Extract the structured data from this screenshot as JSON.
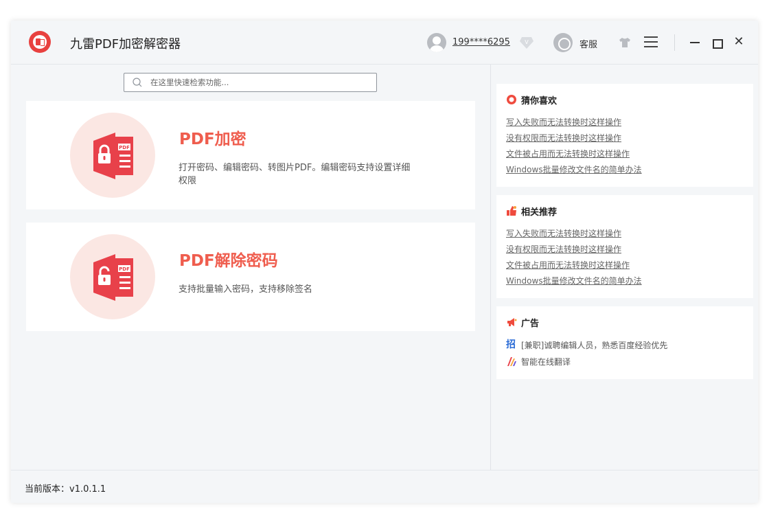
{
  "app": {
    "title": "九雷PDF加密解密器",
    "brand_color": "#e8413f"
  },
  "header": {
    "user_name": "199****6295",
    "service_label": "客服",
    "close_glyph": "✕",
    "icons": [
      "user-avatar-icon",
      "vip-badge-icon",
      "customer-service-icon",
      "skin-icon",
      "menu-icon",
      "minimize-icon",
      "maximize-icon",
      "close-icon"
    ]
  },
  "search": {
    "placeholder": "在这里快速检索功能..."
  },
  "features": [
    {
      "title": "PDF加密",
      "desc": "打开密码、编辑密码、转图片PDF。编辑密码支持设置详细权限",
      "icon": "pdf-lock-icon"
    },
    {
      "title": "PDF解除密码",
      "desc": "支持批量输入密码，支持移除签名",
      "icon": "pdf-unlock-icon"
    }
  ],
  "sidebar": {
    "guess": {
      "title": "猜你喜欢",
      "links": [
        "写入失败而无法转换时这样操作",
        "没有权限而无法转换时这样操作",
        "文件被占用而无法转换时这样操作",
        "Windows批量修改文件名的简单办法"
      ]
    },
    "recommend": {
      "title": "相关推荐",
      "links": [
        "写入失败而无法转换时这样操作",
        "没有权限而无法转换时这样操作",
        "文件被占用而无法转换时这样操作",
        "Windows批量修改文件名的简单办法"
      ]
    },
    "ads": {
      "title": "广告",
      "zhao": "招",
      "items": [
        "[兼职]诚聘编辑人员，熟悉百度经验优先",
        "智能在线翻译"
      ]
    }
  },
  "status": {
    "version": "当前版本：v1.0.1.1"
  },
  "colors": {
    "accent": "#ef5d4e",
    "card_circle": "#fbe7e3",
    "icon_red": "#e8414a"
  }
}
